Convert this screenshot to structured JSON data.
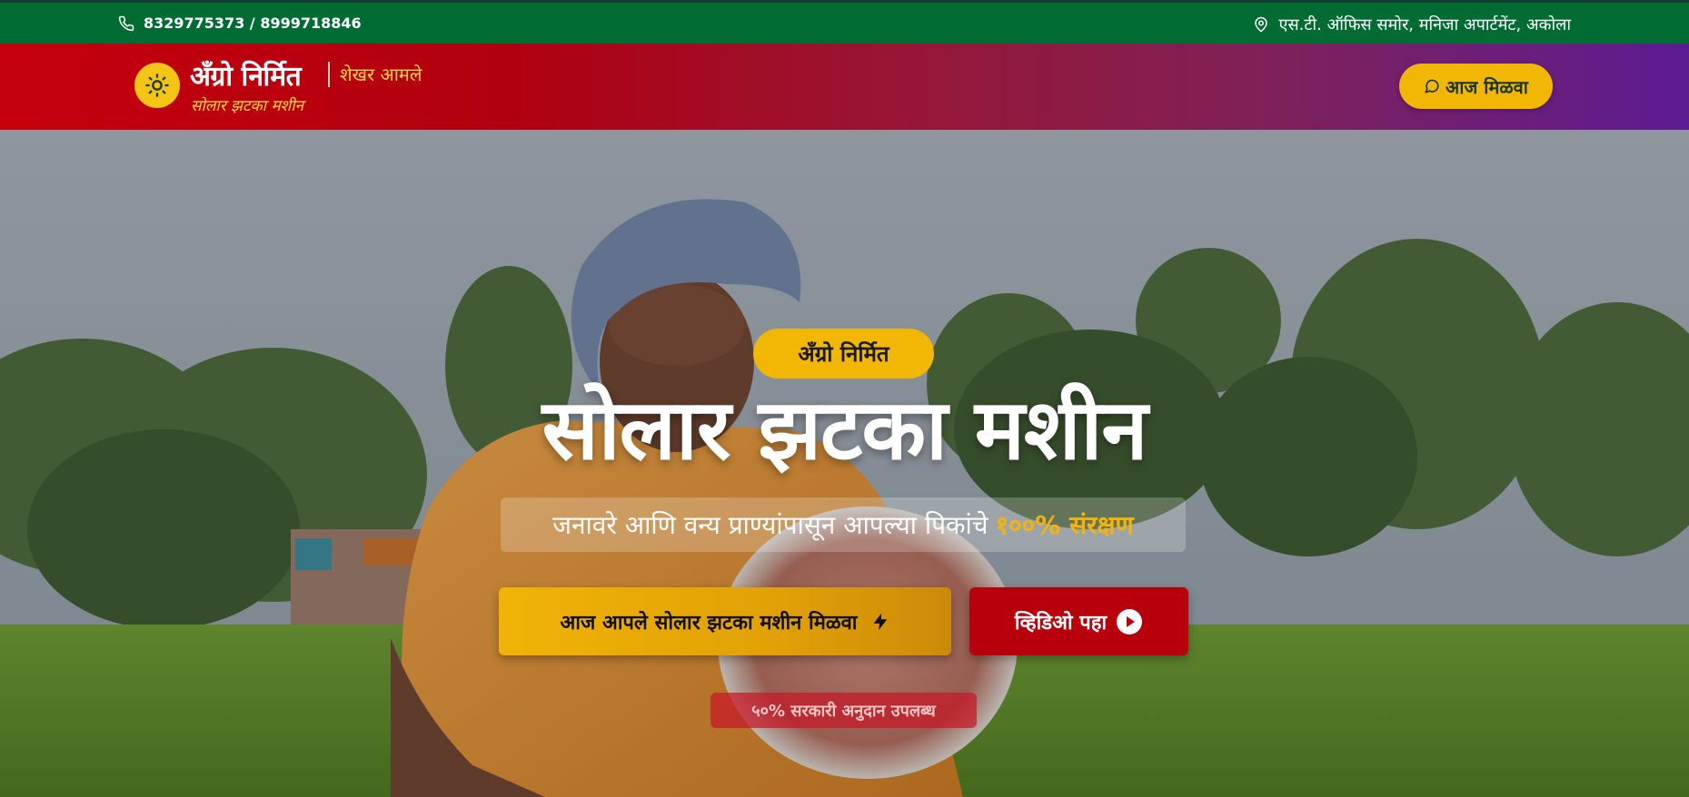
{
  "topbar": {
    "phone": "8329775373 / 8999718846",
    "address": "एस.टी. ऑफिस समोर, मनिजा अपार्टमेंट, अकोला"
  },
  "brand": {
    "name": "अँग्रो निर्मित",
    "owner": "शेखर आमले",
    "tagline": "सोलार झटका मशीन"
  },
  "header": {
    "cta_label": "आज मिळवा"
  },
  "hero": {
    "badge": "अँग्रो निर्मित",
    "title": "सोलार झटका मशीन",
    "subtitle": "जनावरे आणि वन्य प्राण्यांपासून आपल्या पिकांचे",
    "subtitle_highlight": "१००% संरक्षण",
    "primary_button": "आज आपले सोलार झटका मशीन मिळवा",
    "secondary_button": "व्हिडिओ पहा",
    "subsidy_note": "५०% सरकारी अनुदान उपलब्ध"
  },
  "icons": {
    "phone": "phone-icon",
    "location": "location-pin-icon",
    "logo": "sun-icon",
    "chat": "chat-bubble-icon",
    "bolt": "lightning-bolt-icon",
    "play": "play-circle-icon"
  },
  "colors": {
    "topbar": "#006b33",
    "header_start": "#c5000e",
    "header_end": "#5d1c93",
    "accent_yellow": "#f2b705",
    "accent_red": "#b8000d"
  }
}
